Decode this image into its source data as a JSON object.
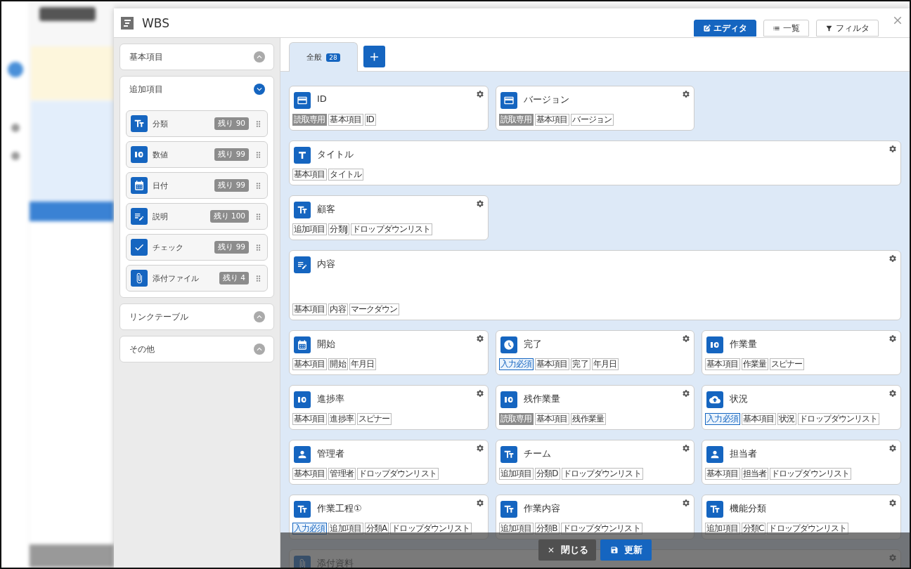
{
  "dialog": {
    "title": "WBS",
    "views": [
      {
        "label": "エディタ",
        "kind": "edit",
        "selected": true
      },
      {
        "label": "一覧",
        "kind": "list",
        "selected": false
      },
      {
        "label": "フィルタ",
        "kind": "filter",
        "selected": false
      }
    ]
  },
  "sidebar": {
    "sections": [
      {
        "title": "基本項目",
        "expanded": false
      },
      {
        "title": "追加項目",
        "expanded": true,
        "items": [
          {
            "kind": "text",
            "label": "分類",
            "remaining": "残り 90"
          },
          {
            "kind": "number",
            "label": "数値",
            "remaining": "残り 99"
          },
          {
            "kind": "calendar",
            "label": "日付",
            "remaining": "残り 99"
          },
          {
            "kind": "note",
            "label": "説明",
            "remaining": "残り 100"
          },
          {
            "kind": "check",
            "label": "チェック",
            "remaining": "残り 99"
          },
          {
            "kind": "clip",
            "label": "添付ファイル",
            "remaining": "残り 4"
          }
        ]
      },
      {
        "title": "リンクテーブル",
        "expanded": false
      },
      {
        "title": "その他",
        "expanded": false
      }
    ]
  },
  "tabs": [
    {
      "label": "全般",
      "count": "28",
      "selected": true
    }
  ],
  "fields": [
    {
      "kind": "card",
      "title": "ID",
      "wide": false,
      "tags": [
        {
          "label": "読取専用",
          "kind": "readonly"
        },
        {
          "label": "基本項目",
          "kind": "plain"
        },
        {
          "label": "ID",
          "kind": "plain"
        }
      ]
    },
    {
      "kind": "card",
      "title": "バージョン",
      "wide": false,
      "tags": [
        {
          "label": "読取専用",
          "kind": "readonly"
        },
        {
          "label": "基本項目",
          "kind": "plain"
        },
        {
          "label": "バージョン",
          "kind": "plain"
        }
      ]
    },
    {
      "kind": "title",
      "title": "タイトル",
      "wide": true,
      "tags": [
        {
          "label": "基本項目",
          "kind": "plain"
        },
        {
          "label": "タイトル",
          "kind": "plain"
        }
      ]
    },
    {
      "kind": "text",
      "title": "顧客",
      "wide": false,
      "tags": [
        {
          "label": "追加項目",
          "kind": "plain"
        },
        {
          "label": "分類J",
          "kind": "plain"
        },
        {
          "label": "ドロップダウンリスト",
          "kind": "plain"
        }
      ]
    },
    {
      "kind": "note",
      "title": "内容",
      "wide": true,
      "tall": true,
      "tags": [
        {
          "label": "基本項目",
          "kind": "plain"
        },
        {
          "label": "内容",
          "kind": "plain"
        },
        {
          "label": "マークダウン",
          "kind": "plain"
        }
      ]
    },
    {
      "kind": "calendar",
      "title": "開始",
      "wide": false,
      "tags": [
        {
          "label": "基本項目",
          "kind": "plain"
        },
        {
          "label": "開始",
          "kind": "plain"
        },
        {
          "label": "年月日",
          "kind": "plain"
        }
      ]
    },
    {
      "kind": "clock",
      "title": "完了",
      "wide": false,
      "tags": [
        {
          "label": "入力必須",
          "kind": "required"
        },
        {
          "label": "基本項目",
          "kind": "plain"
        },
        {
          "label": "完了",
          "kind": "plain"
        },
        {
          "label": "年月日",
          "kind": "plain"
        }
      ]
    },
    {
      "kind": "number",
      "title": "作業量",
      "wide": false,
      "tags": [
        {
          "label": "基本項目",
          "kind": "plain"
        },
        {
          "label": "作業量",
          "kind": "plain"
        },
        {
          "label": "スピナー",
          "kind": "plain"
        }
      ]
    },
    {
      "kind": "number",
      "title": "進捗率",
      "wide": false,
      "tags": [
        {
          "label": "基本項目",
          "kind": "plain"
        },
        {
          "label": "進捗率",
          "kind": "plain"
        },
        {
          "label": "スピナー",
          "kind": "plain"
        }
      ]
    },
    {
      "kind": "number",
      "title": "残作業量",
      "wide": false,
      "tags": [
        {
          "label": "読取専用",
          "kind": "readonly"
        },
        {
          "label": "基本項目",
          "kind": "plain"
        },
        {
          "label": "残作業量",
          "kind": "plain"
        }
      ]
    },
    {
      "kind": "status",
      "title": "状況",
      "wide": false,
      "tags": [
        {
          "label": "入力必須",
          "kind": "required"
        },
        {
          "label": "基本項目",
          "kind": "plain"
        },
        {
          "label": "状況",
          "kind": "plain"
        },
        {
          "label": "ドロップダウンリスト",
          "kind": "plain"
        }
      ]
    },
    {
      "kind": "person",
      "title": "管理者",
      "wide": false,
      "tags": [
        {
          "label": "基本項目",
          "kind": "plain"
        },
        {
          "label": "管理者",
          "kind": "plain"
        },
        {
          "label": "ドロップダウンリスト",
          "kind": "plain"
        }
      ]
    },
    {
      "kind": "text",
      "title": "チーム",
      "wide": false,
      "tags": [
        {
          "label": "追加項目",
          "kind": "plain"
        },
        {
          "label": "分類D",
          "kind": "plain"
        },
        {
          "label": "ドロップダウンリスト",
          "kind": "plain"
        }
      ]
    },
    {
      "kind": "person",
      "title": "担当者",
      "wide": false,
      "tags": [
        {
          "label": "基本項目",
          "kind": "plain"
        },
        {
          "label": "担当者",
          "kind": "plain"
        },
        {
          "label": "ドロップダウンリスト",
          "kind": "plain"
        }
      ]
    },
    {
      "kind": "text",
      "title": "作業工程①",
      "wide": false,
      "tags": [
        {
          "label": "入力必須",
          "kind": "required"
        },
        {
          "label": "追加項目",
          "kind": "plain"
        },
        {
          "label": "分類A",
          "kind": "plain"
        },
        {
          "label": "ドロップダウンリスト",
          "kind": "plain"
        }
      ]
    },
    {
      "kind": "text",
      "title": "作業内容",
      "wide": false,
      "tags": [
        {
          "label": "追加項目",
          "kind": "plain"
        },
        {
          "label": "分類B",
          "kind": "plain"
        },
        {
          "label": "ドロップダウンリスト",
          "kind": "plain"
        }
      ]
    },
    {
      "kind": "text",
      "title": "機能分類",
      "wide": false,
      "tags": [
        {
          "label": "追加項目",
          "kind": "plain"
        },
        {
          "label": "分類C",
          "kind": "plain"
        },
        {
          "label": "ドロップダウンリスト",
          "kind": "plain"
        }
      ]
    },
    {
      "kind": "clip",
      "title": "添付資料",
      "wide": true
    }
  ],
  "footer": {
    "buttons": [
      {
        "label": "閉じる",
        "kind": "close"
      },
      {
        "label": "更新",
        "kind": "save"
      }
    ]
  }
}
